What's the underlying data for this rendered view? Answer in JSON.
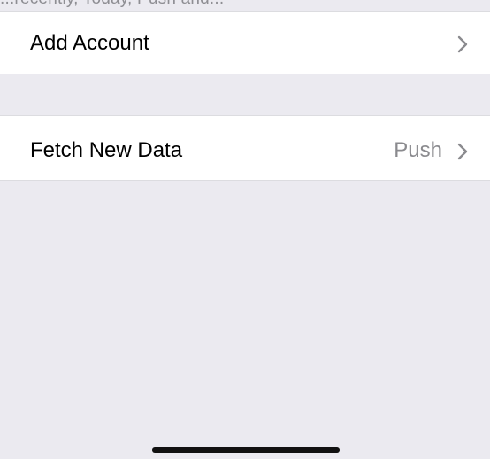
{
  "header_clipped_text": "...recently, Today, Push and...",
  "rows": [
    {
      "label": "Add Account",
      "value": "",
      "icon": "chevron-right-icon"
    },
    {
      "label": "Fetch New Data",
      "value": "Push",
      "icon": "chevron-right-icon"
    }
  ],
  "colors": {
    "background": "#ebeaf0",
    "cell": "#ffffff",
    "secondary_text": "#8a8a8e",
    "separator": "#dcdce0"
  }
}
